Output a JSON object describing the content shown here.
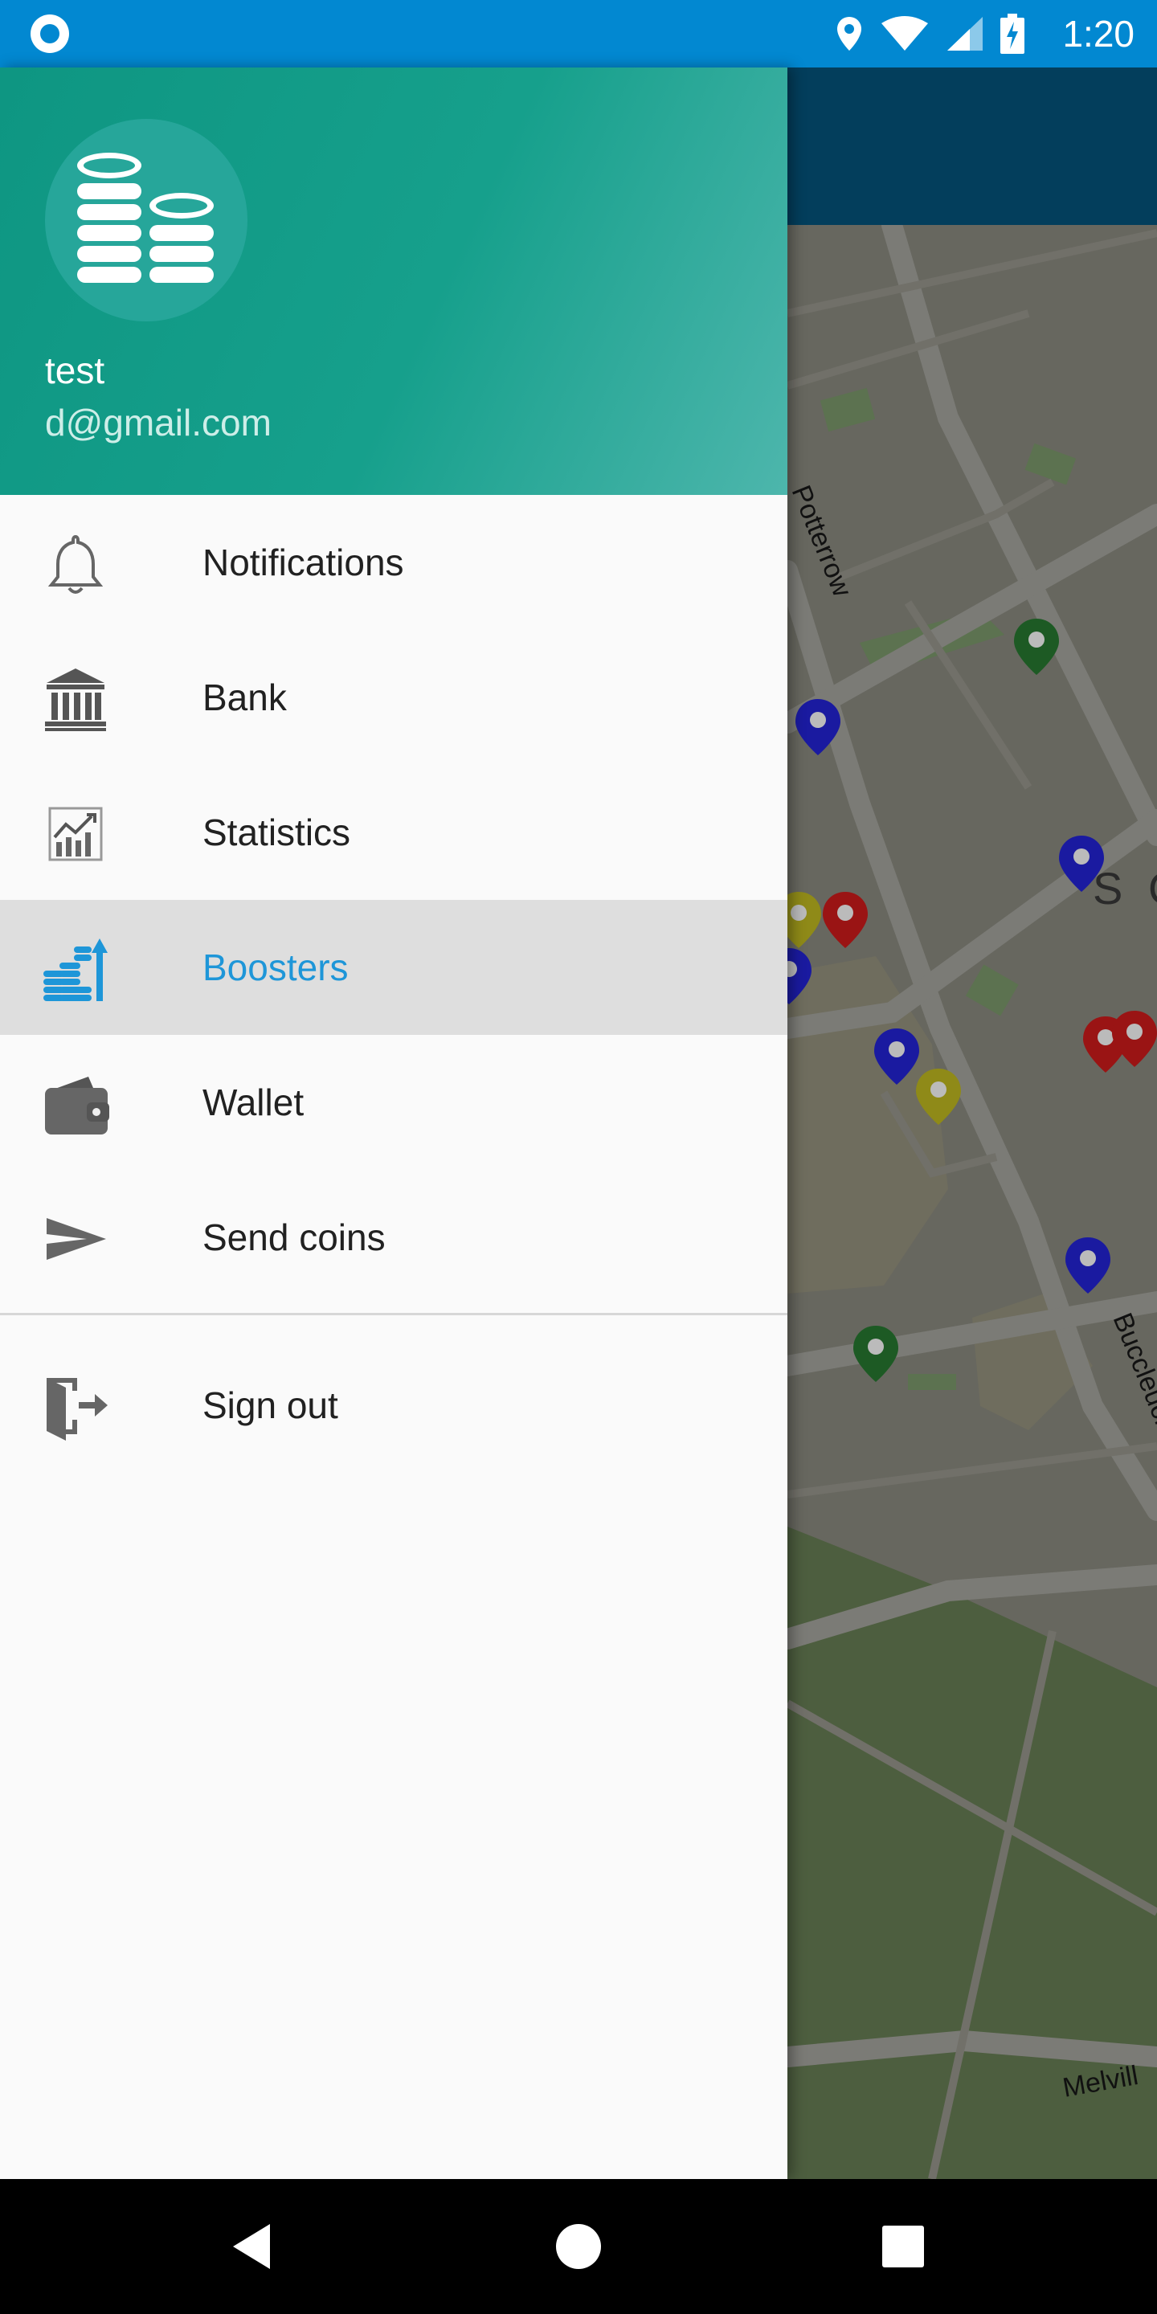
{
  "status_bar": {
    "time": "1:20",
    "icons": [
      "location-icon",
      "wifi-icon",
      "signal-icon",
      "battery-charging-icon"
    ]
  },
  "drawer": {
    "header": {
      "name": "test",
      "email": "d@gmail.com"
    },
    "items": [
      {
        "label": "Notifications",
        "icon": "bell-icon",
        "active": false
      },
      {
        "label": "Bank",
        "icon": "bank-icon",
        "active": false
      },
      {
        "label": "Statistics",
        "icon": "chart-icon",
        "active": false
      },
      {
        "label": "Boosters",
        "icon": "coins-booster-icon",
        "active": true
      },
      {
        "label": "Wallet",
        "icon": "wallet-icon",
        "active": false
      },
      {
        "label": "Send coins",
        "icon": "send-icon",
        "active": false
      }
    ],
    "sign_out": {
      "label": "Sign out",
      "icon": "sign-out-icon"
    }
  },
  "map": {
    "street_labels": [
      "Potterrow",
      "Buccleuch",
      "Melvill",
      "S C"
    ]
  },
  "colors": {
    "status_bar": "#0288d1",
    "app_bar": "#033e5c",
    "header_start": "#0e9682",
    "header_end": "#4db6ac",
    "accent": "#1e96d8",
    "marker_blue": "#1a1aa0",
    "marker_red": "#9a1414",
    "marker_green": "#1d5a24",
    "marker_yellow": "#8f8a18"
  }
}
